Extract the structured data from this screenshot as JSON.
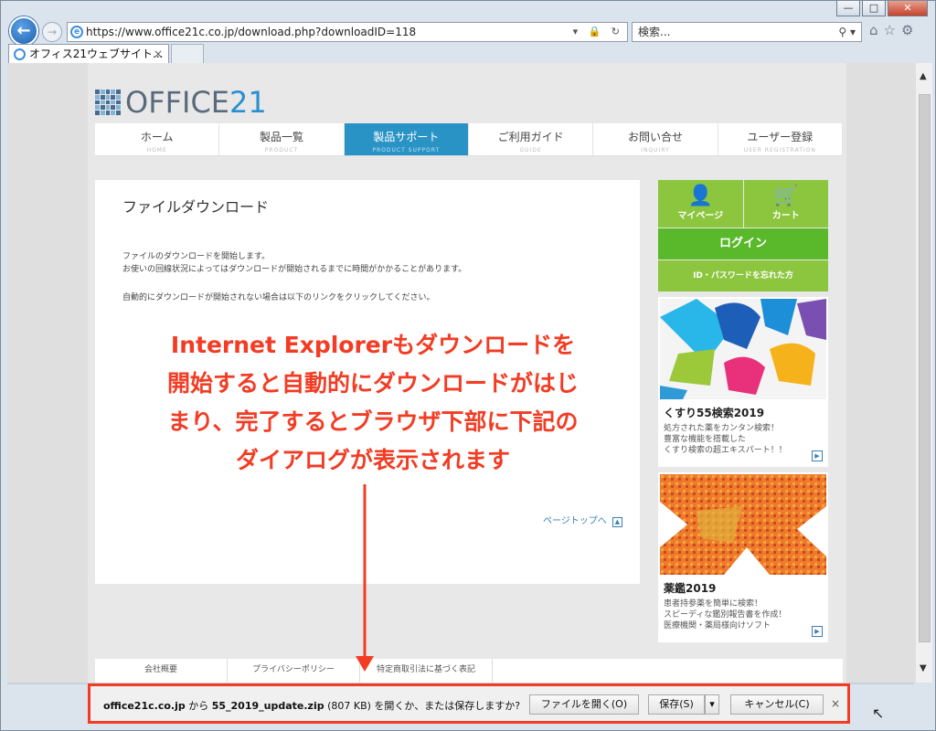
{
  "window": {
    "controls": {
      "minimize": "—",
      "maximize": "□",
      "close": "✕"
    }
  },
  "toolbar": {
    "back_icon": "←",
    "forward_icon": "→",
    "url": "https://www.office21c.co.jp/download.php?downloadID=118",
    "url_controls": "▾ 🔒 ↻",
    "search_placeholder": "検索...",
    "search_controls": "⚲ ▾",
    "tool_icons": [
      "⌂",
      "☆",
      "⚙"
    ]
  },
  "tabs": [
    {
      "label": "オフィス21ウェブサイト...",
      "close": "×"
    }
  ],
  "site": {
    "logo": {
      "prefix": "OFFICE",
      "suffix": "21"
    },
    "nav": [
      {
        "jp": "ホーム",
        "en": "HOME"
      },
      {
        "jp": "製品一覧",
        "en": "PRODUCT"
      },
      {
        "jp": "製品サポート",
        "en": "PRODUCT SUPPORT"
      },
      {
        "jp": "ご利用ガイド",
        "en": "GUIDE"
      },
      {
        "jp": "お問い合せ",
        "en": "INQUIRY"
      },
      {
        "jp": "ユーザー登録",
        "en": "USER REGISTRATION"
      }
    ],
    "content": {
      "title": "ファイルダウンロード",
      "p1": "ファイルのダウンロードを開始します。",
      "p2": "お使いの回線状況によってはダウンロードが開始されるまでに時間がかかることがあります。",
      "p3": "自動的にダウンロードが開始されない場合は以下のリンクをクリックしてください。",
      "pagetop": "ページトップへ",
      "pagetop_icon": "▲"
    },
    "sidebar": {
      "mypage": "マイページ",
      "cart": "カート",
      "login": "ログイン",
      "forgot": "ID・パスワードを忘れた方",
      "banners": [
        {
          "title": "くすり55検索2019",
          "lines": [
            "処方された薬をカンタン検索！",
            "豊富な機能を搭載した",
            "くすり検索の超エキスパート！！"
          ],
          "go": "▶"
        },
        {
          "title": "薬鑑2019",
          "lines": [
            "患者持参薬を簡単に検索！",
            "スピーディな鑑別報告書を作成！",
            "医療機関・薬局様向けソフト"
          ],
          "go": "▶"
        }
      ]
    },
    "footer": [
      "会社概要",
      "プライバシーポリシー",
      "特定商取引法に基づく表記"
    ]
  },
  "annotation": {
    "lines": [
      "Internet Explorerもダウンロードを",
      "開始すると自動的にダウンロードがはじ",
      "まり、完了するとブラウザ下部に下記の",
      "ダイアログが表示されます"
    ],
    "color": "#f23c24"
  },
  "notification": {
    "host": "office21c.co.jp",
    "from": " から ",
    "file": "55_2019_update.zip",
    "size": " (807 KB) ",
    "question": "を開くか、または保存しますか?",
    "open_btn": "ファイルを開く(O)",
    "save_btn": "保存(S)",
    "save_dropdown": "▾",
    "cancel_btn": "キャンセル(C)",
    "close": "×"
  },
  "colors": {
    "accent": "#2a93c6",
    "green": "#8cc63f",
    "login_green": "#5ab82b",
    "highlight": "#f23c24"
  }
}
